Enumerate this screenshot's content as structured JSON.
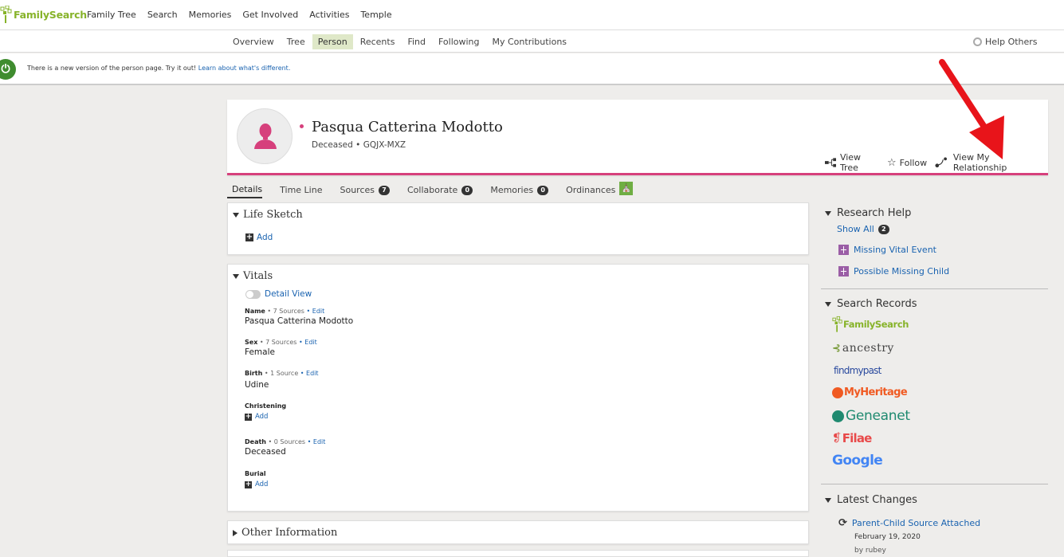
{
  "brand": {
    "logo_text": "FamilySearch"
  },
  "main_nav": [
    "Family Tree",
    "Search",
    "Memories",
    "Get Involved",
    "Activities",
    "Temple"
  ],
  "sub_nav": {
    "items": [
      "Overview",
      "Tree",
      "Person",
      "Recents",
      "Find",
      "Following",
      "My Contributions"
    ],
    "active": "Person",
    "help_others": "Help Others"
  },
  "banner": {
    "text": "There is a new version of the person page. Try it out!",
    "link": "Learn about what's different."
  },
  "person": {
    "name": "Pasqua Catterina Modotto",
    "status": "Deceased",
    "separator": "•",
    "pid": "GQJX-MXZ",
    "actions": {
      "view_tree": "View Tree",
      "follow": "Follow",
      "view_relationship": "View My Relationship"
    }
  },
  "tabs": [
    {
      "label": "Details"
    },
    {
      "label": "Time Line"
    },
    {
      "label": "Sources",
      "count": "7"
    },
    {
      "label": "Collaborate",
      "count": "0"
    },
    {
      "label": "Memories",
      "count": "0"
    },
    {
      "label": "Ordinances"
    }
  ],
  "life_sketch": {
    "title": "Life Sketch",
    "add": "Add"
  },
  "vitals": {
    "title": "Vitals",
    "detail_view": "Detail View",
    "name": {
      "label": "Name",
      "sources": "7 Sources",
      "edit": "Edit",
      "value": "Pasqua Catterina Modotto"
    },
    "sex": {
      "label": "Sex",
      "sources": "7 Sources",
      "edit": "Edit",
      "value": "Female"
    },
    "birth": {
      "label": "Birth",
      "sources": "1 Source",
      "edit": "Edit",
      "value": "Udine"
    },
    "christening": {
      "label": "Christening",
      "add": "Add"
    },
    "death": {
      "label": "Death",
      "sources": "0 Sources",
      "edit": "Edit",
      "value": "Deceased"
    },
    "burial": {
      "label": "Burial",
      "add": "Add"
    },
    "dot": "•"
  },
  "other_info": {
    "title": "Other Information"
  },
  "sidebar": {
    "research_help": {
      "title": "Research Help",
      "show_all": "Show All",
      "count": "2",
      "items": [
        "Missing Vital Event",
        "Possible Missing Child"
      ]
    },
    "search_records": {
      "title": "Search Records",
      "providers": [
        "FamilySearch",
        "ancestry",
        "findmypast",
        "MyHeritage",
        "Geneanet",
        "Filae",
        "Google"
      ]
    },
    "latest_changes": {
      "title": "Latest Changes",
      "item": "Parent-Child Source Attached",
      "date": "February 19, 2020",
      "by": "by rubey"
    }
  },
  "colors": {
    "accent_pink": "#d6407c",
    "link_blue": "#1a63b0",
    "brand_green": "#87b32a",
    "arrow_red": "#e8141a"
  }
}
